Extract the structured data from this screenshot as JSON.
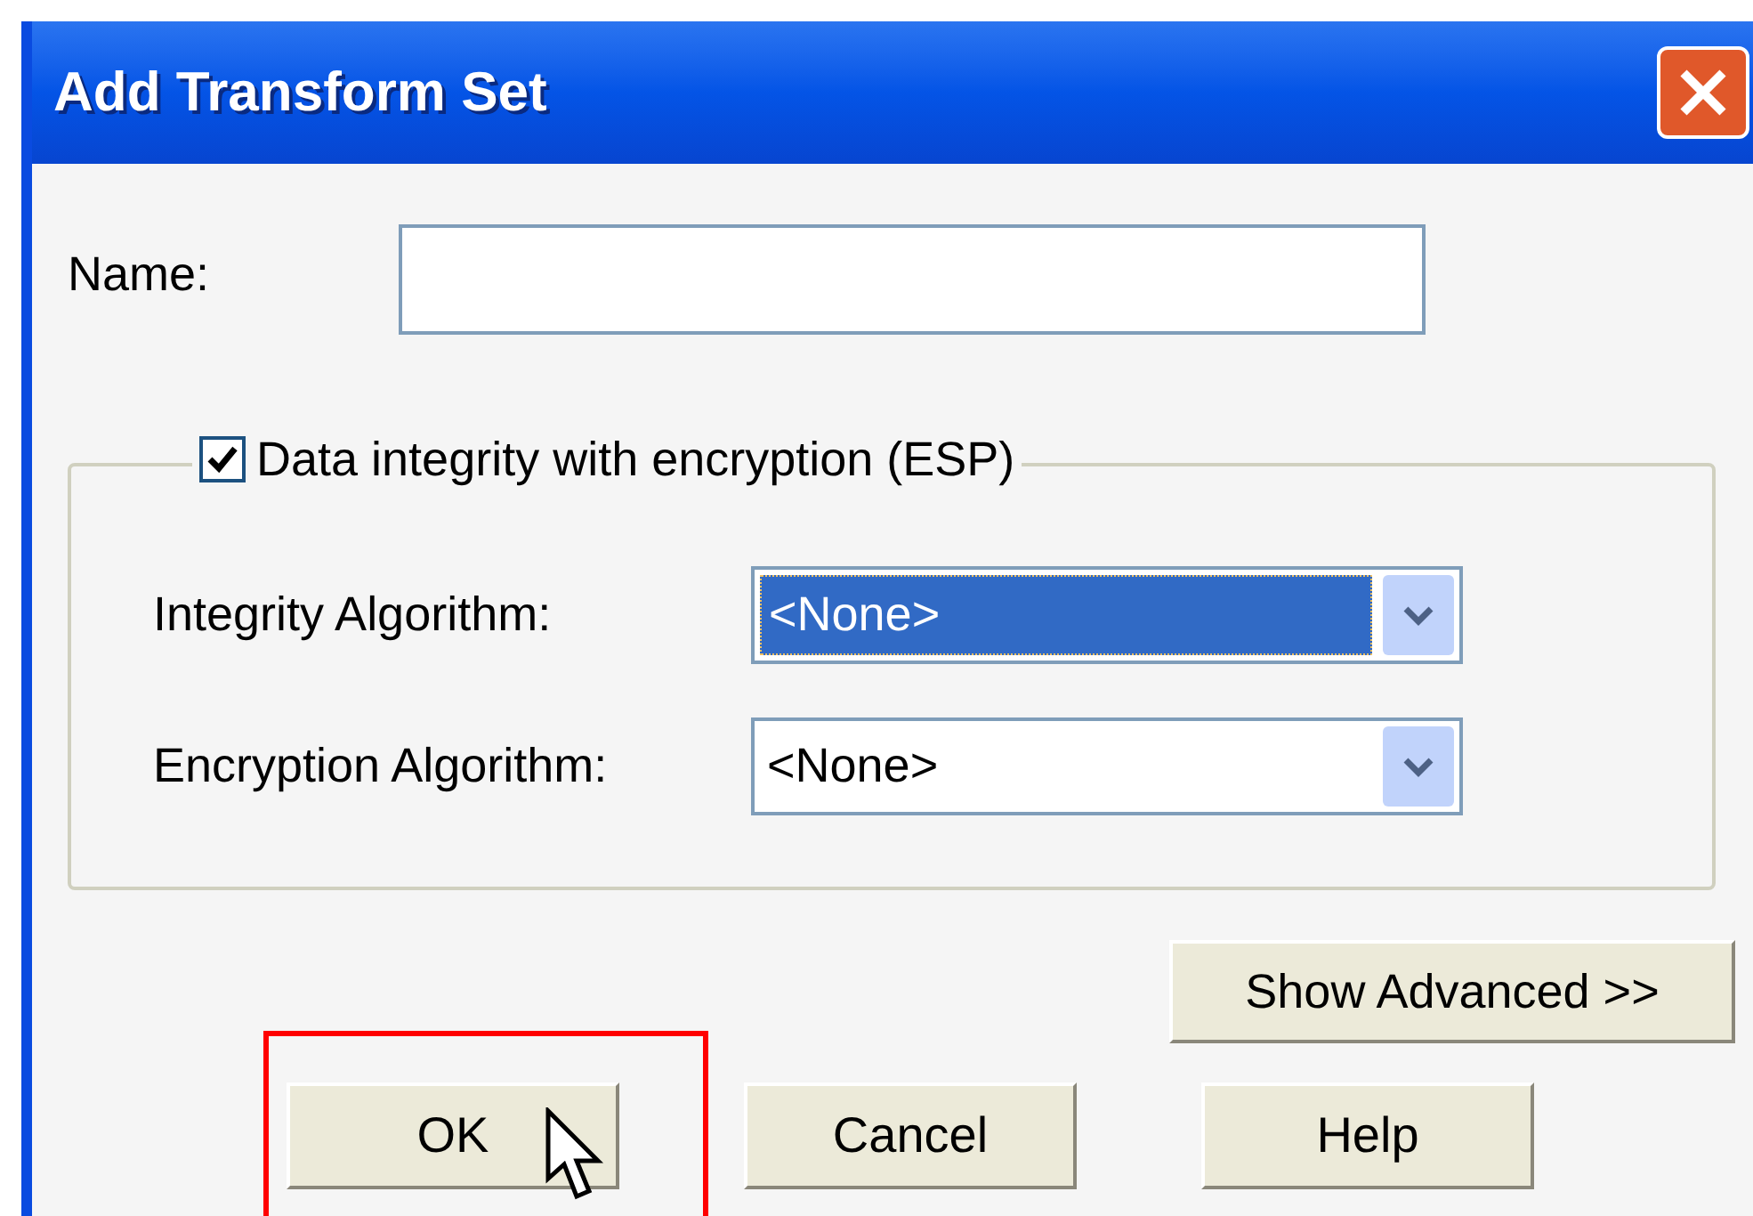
{
  "window": {
    "title": "Add Transform Set"
  },
  "name_field": {
    "label": "Name:"
  },
  "esp_group": {
    "label": "Data integrity with encryption (ESP)",
    "checked": true
  },
  "algorithms": [
    {
      "label": "Integrity Algorithm:",
      "value": "<None>",
      "selected": true
    },
    {
      "label": "Encryption Algorithm:",
      "value": "<None>",
      "selected": false
    }
  ],
  "advanced_button": "Show Advanced >>",
  "buttons": [
    {
      "label": "OK",
      "highlighted": true
    },
    {
      "label": "Cancel",
      "highlighted": false
    },
    {
      "label": "Help",
      "highlighted": false
    }
  ]
}
